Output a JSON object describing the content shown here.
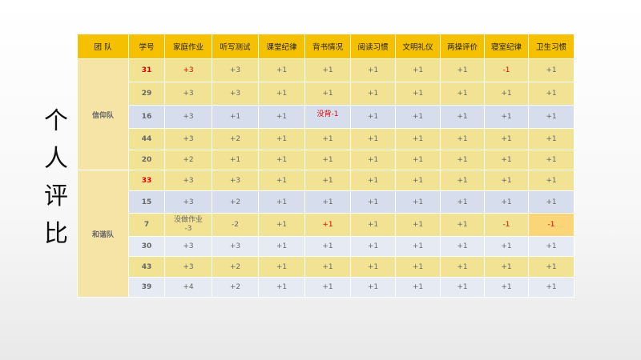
{
  "side_title": [
    "个",
    "人",
    "评",
    "比"
  ],
  "headers": [
    "团 队",
    "学号",
    "家庭作业",
    "听写测试",
    "课堂纪律",
    "背书情况",
    "阅读习惯",
    "文明礼仪",
    "两操评价",
    "寝室纪律",
    "卫生习惯"
  ],
  "teams": [
    {
      "name": "信仰队",
      "rows": [
        {
          "id": "31",
          "cells": [
            "+3",
            "+3",
            "+1",
            "+1",
            "+1",
            "+1",
            "+1",
            "-1",
            "+1"
          ]
        },
        {
          "id": "29",
          "cells": [
            "+3",
            "+3",
            "+1",
            "+1",
            "+1",
            "+1",
            "+1",
            "+1",
            "+1"
          ]
        },
        {
          "id": "16",
          "cells": [
            "+3",
            "+1",
            "+1",
            "没背-1",
            "+1",
            "+1",
            "+1",
            "+1",
            "+1"
          ]
        },
        {
          "id": "44",
          "cells": [
            "+3",
            "+2",
            "+1",
            "+1",
            "+1",
            "+1",
            "+1",
            "+1",
            "+1"
          ]
        },
        {
          "id": "20",
          "cells": [
            "+2",
            "+1",
            "+1",
            "+1",
            "+1",
            "+1",
            "+1",
            "+1",
            "+1"
          ]
        }
      ]
    },
    {
      "name": "和谐队",
      "rows": [
        {
          "id": "33",
          "cells": [
            "+3",
            "+3",
            "+1",
            "+1",
            "+1",
            "+1",
            "+1",
            "+1",
            "+1"
          ]
        },
        {
          "id": "15",
          "cells": [
            "+3",
            "+2",
            "+1",
            "+1",
            "+1",
            "+1",
            "+1",
            "+1",
            "+1"
          ]
        },
        {
          "id": "7",
          "cells": [
            "没做作业",
            "-2",
            "+1",
            "+1",
            "+1",
            "+1",
            "+1",
            "-1",
            "-1"
          ],
          "homework_extra": "-3"
        },
        {
          "id": "30",
          "cells": [
            "+3",
            "+3",
            "+1",
            "+1",
            "+1",
            "+1",
            "+1",
            "+1",
            "+1"
          ]
        },
        {
          "id": "43",
          "cells": [
            "+3",
            "+2",
            "+1",
            "+1",
            "+1",
            "+1",
            "+1",
            "+1",
            "+1"
          ]
        },
        {
          "id": "39",
          "cells": [
            "+4",
            "+2",
            "+1",
            "+1",
            "+1",
            "+1",
            "+1",
            "+1",
            "+1"
          ]
        }
      ]
    }
  ],
  "colors": {
    "header": "#f5c000",
    "team_cell": "#f6e3a6",
    "row_yellow": "#f2e394",
    "row_blue": "#d6deed",
    "row_light_blue": "#e6ebf3",
    "highlight": "#fad678",
    "red_text": "#e00000"
  }
}
